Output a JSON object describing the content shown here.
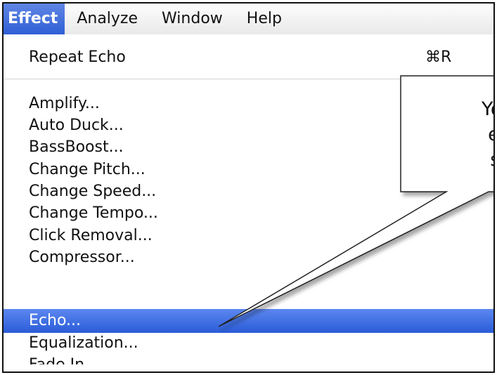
{
  "menubar": {
    "items": [
      "Effect",
      "Analyze",
      "Window",
      "Help"
    ]
  },
  "menu": {
    "repeat": {
      "label": "Repeat Echo",
      "shortcut": "⌘R"
    },
    "items": [
      "Amplify...",
      "Auto Duck...",
      "BassBoost...",
      "Change Pitch...",
      "Change Speed...",
      "Change Tempo...",
      "Click Removal...",
      "Compressor...",
      "Echo...",
      "Equalization...",
      "Fade In"
    ],
    "selected": "Echo..."
  },
  "callout": {
    "lines": [
      "You c",
      "effe",
      "sec"
    ]
  },
  "colors": {
    "selection": "#2f5fd6",
    "menubar_bg": "#eeeeee"
  }
}
